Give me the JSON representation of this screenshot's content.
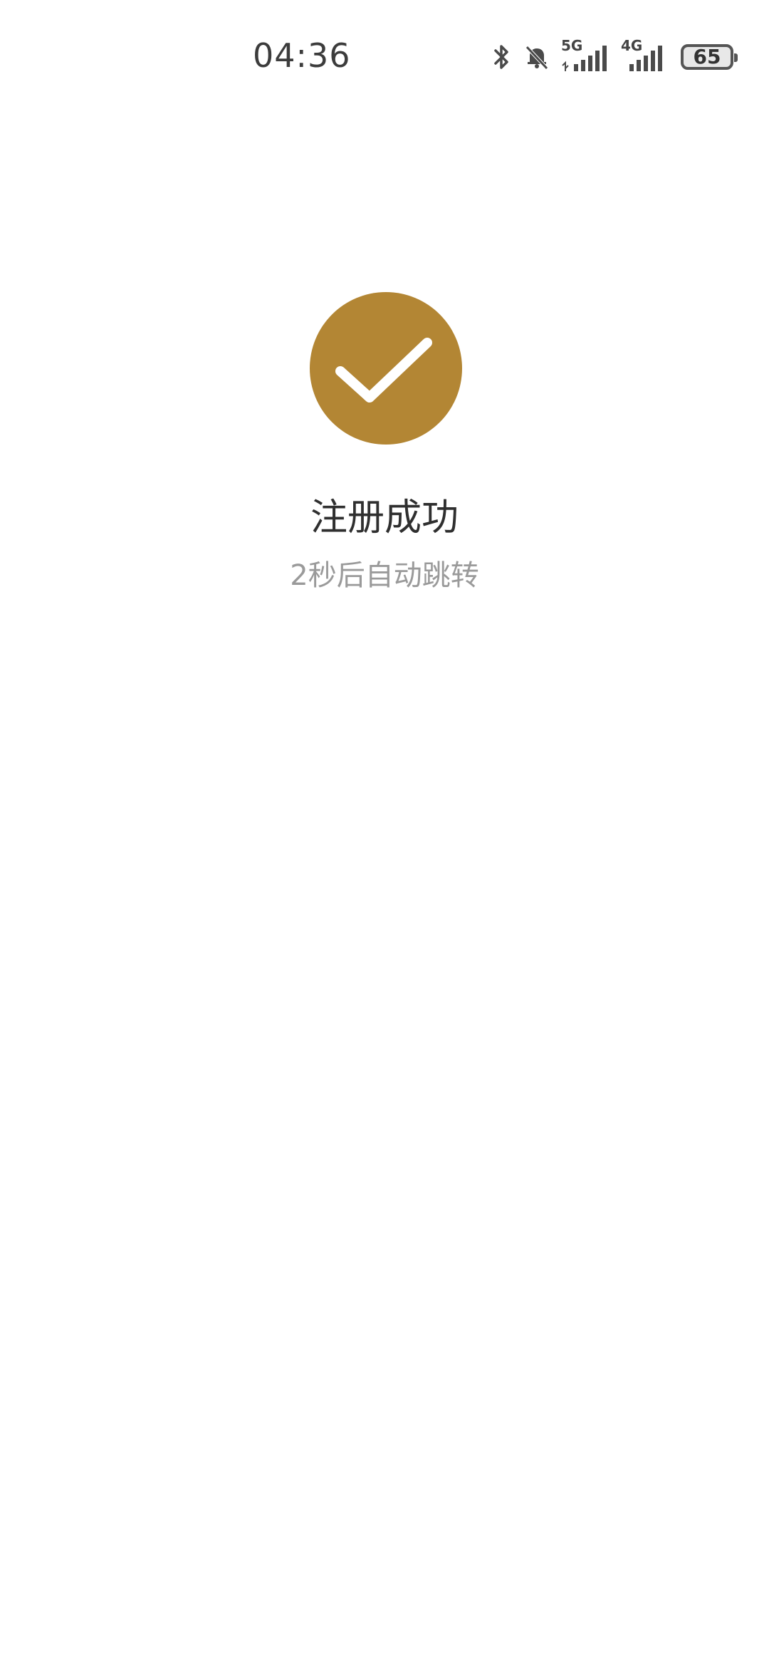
{
  "status_bar": {
    "time": "04:36",
    "battery_level": "65",
    "network_1_label": "5G",
    "network_2_label": "4G",
    "icons": [
      "bluetooth-icon",
      "muted-bell-icon",
      "signal-5g-icon",
      "signal-4g-icon",
      "battery-icon"
    ]
  },
  "success": {
    "icon": "checkmark-icon",
    "icon_color": "#b38634",
    "title": "注册成功",
    "subtitle": "2秒后自动跳转"
  }
}
